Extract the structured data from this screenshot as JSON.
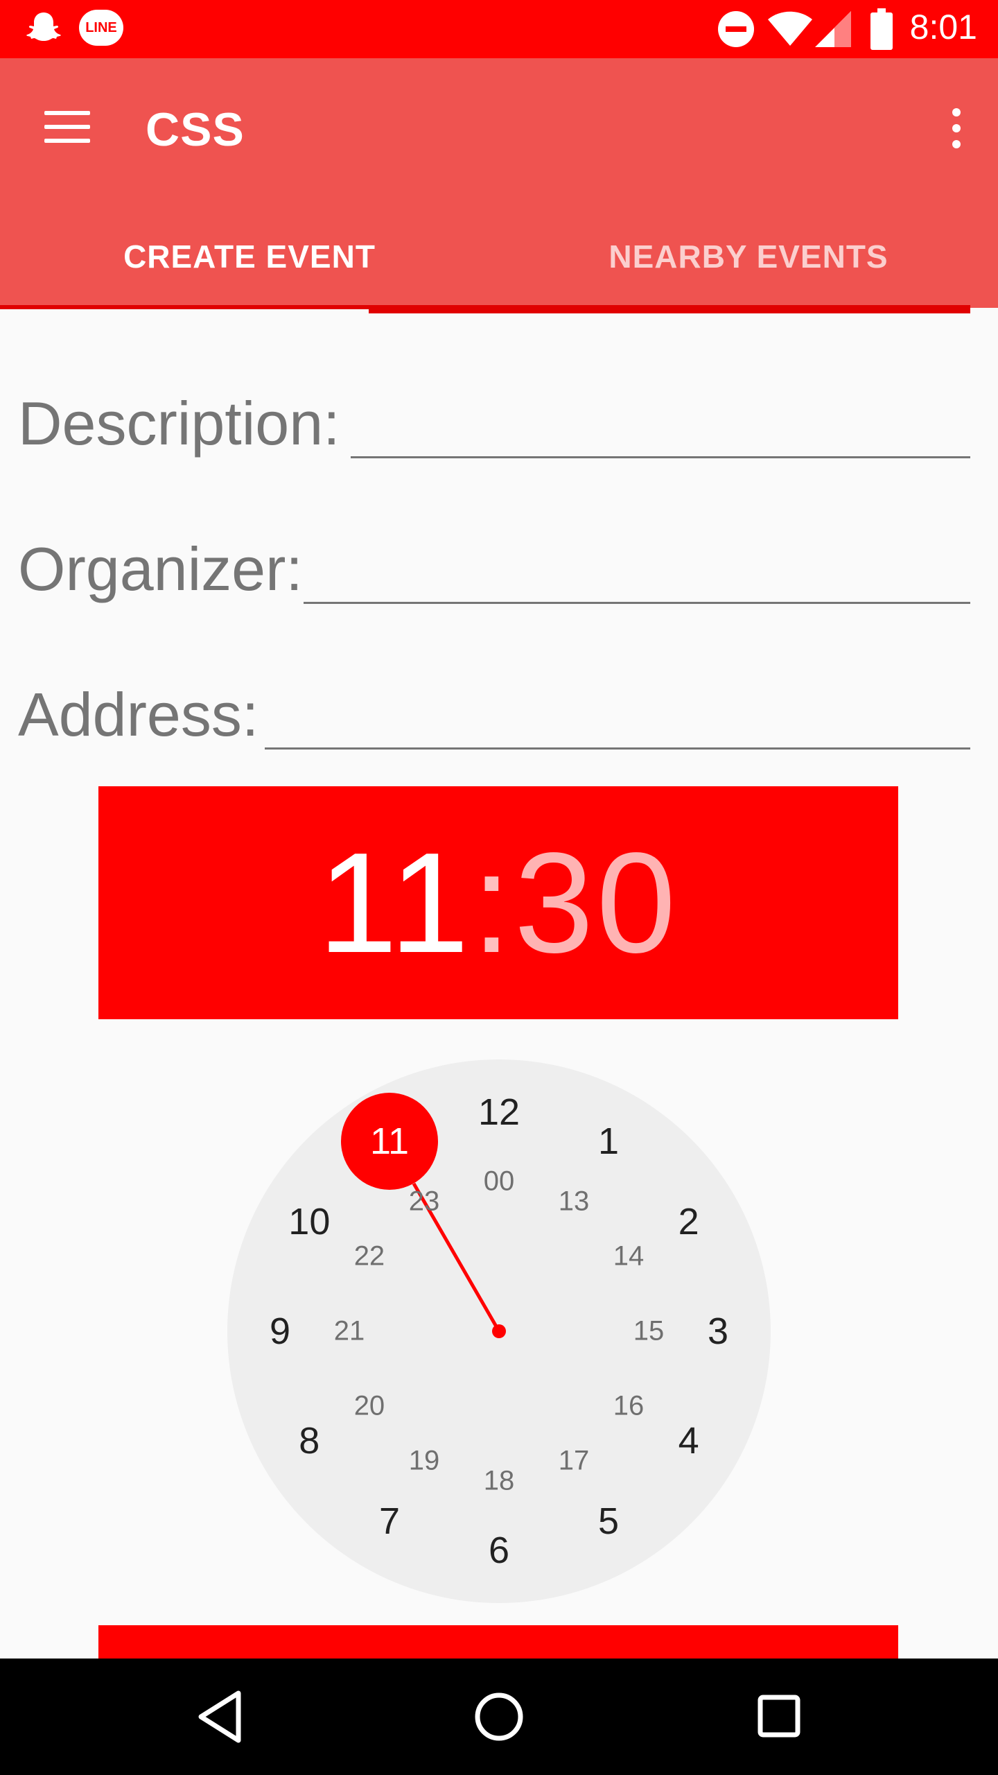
{
  "status_bar": {
    "time": "8:01",
    "left_icons": [
      "snapchat-icon",
      "line-icon"
    ],
    "right_icons": [
      "do-not-disturb-icon",
      "wifi-icon",
      "signal-icon",
      "battery-icon"
    ],
    "line_badge_text": "LINE",
    "background": "#ff0000"
  },
  "app_bar": {
    "title": "CSS",
    "background": "#ef5350"
  },
  "tabs": [
    {
      "label": "CREATE EVENT",
      "selected": true
    },
    {
      "label": "NEARBY EVENTS",
      "selected": false
    }
  ],
  "form": {
    "description_label": "Description:",
    "description_value": "",
    "organizer_label": "Organizer:",
    "organizer_value": "",
    "address_label": "Address:",
    "address_value": ""
  },
  "time_picker": {
    "hour": "11",
    "separator": ":",
    "minute": "30",
    "accent": "#ff0000",
    "selected_hour": "11",
    "outer_hours": [
      "12",
      "1",
      "2",
      "3",
      "4",
      "5",
      "6",
      "7",
      "8",
      "9",
      "10",
      "11"
    ],
    "inner_hours": [
      "00",
      "13",
      "14",
      "15",
      "16",
      "17",
      "18",
      "19",
      "20",
      "21",
      "22",
      "23"
    ]
  },
  "nav_bar": {
    "buttons": [
      "back-icon",
      "home-icon",
      "recents-icon"
    ]
  }
}
